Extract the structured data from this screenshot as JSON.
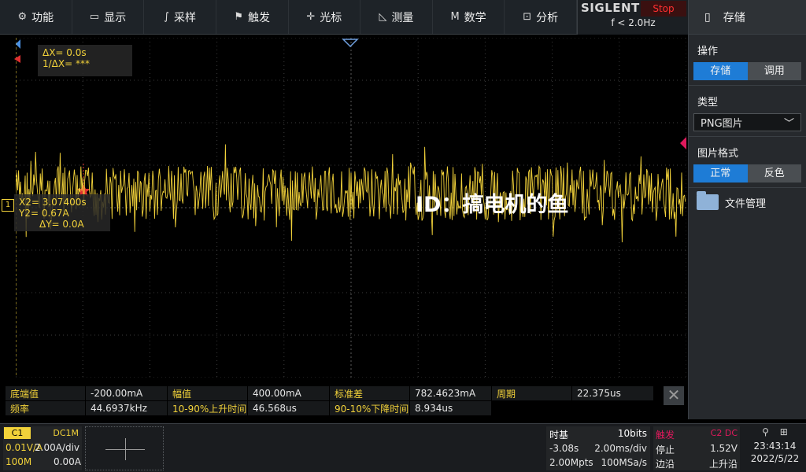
{
  "menu": [
    {
      "icon": "gear-icon",
      "glyph": "⚙",
      "label": "功能"
    },
    {
      "icon": "display-icon",
      "glyph": "▭",
      "label": "显示"
    },
    {
      "icon": "acquire-icon",
      "glyph": "∫",
      "label": "采样"
    },
    {
      "icon": "flag-icon",
      "glyph": "⚑",
      "label": "触发"
    },
    {
      "icon": "cursor-icon",
      "glyph": "✛",
      "label": "光标"
    },
    {
      "icon": "measure-icon",
      "glyph": "◺",
      "label": "测量"
    },
    {
      "icon": "math-icon",
      "glyph": "M",
      "label": "数学"
    },
    {
      "icon": "analysis-icon",
      "glyph": "⊡",
      "label": "分析"
    }
  ],
  "brand": {
    "logo": "SIGLENT",
    "status": "Stop",
    "freq": "f < 2.0Hz"
  },
  "panel": {
    "title": "存储",
    "op_label": "操作",
    "op_options": [
      "存储",
      "调用"
    ],
    "type_label": "类型",
    "type_value": "PNG图片",
    "format_label": "图片格式",
    "format_options": [
      "正常",
      "反色"
    ],
    "file_manager": "文件管理"
  },
  "cursor": {
    "dx": "ΔX= 0.0s",
    "inv_dx": "1/ΔX= ***",
    "x2": "X2= 3.07400s",
    "y2": "Y2= 0.67A",
    "dy": "ΔY= 0.0A"
  },
  "watermark": "ID：搞电机的鱼",
  "measurements": [
    [
      {
        "k": "底端值",
        "v": "-200.00mA"
      },
      {
        "k": "幅值",
        "v": "400.00mA"
      },
      {
        "k": "标准差",
        "v": "782.4623mA"
      },
      {
        "k": "周期",
        "v": "22.375us"
      }
    ],
    [
      {
        "k": "频率",
        "v": "44.6937kHz"
      },
      {
        "k": "10-90%上升时间",
        "v": "46.568us"
      },
      {
        "k": "90-10%下降时间",
        "v": "8.934us"
      }
    ]
  ],
  "channel1": {
    "tag": "C1",
    "coupling": "DC1M",
    "probe": "0.01V/A",
    "scale": "2.00A/div",
    "bandwidth": "100M",
    "offset": "0.00A"
  },
  "timebase": {
    "label": "时基",
    "bits": "10bits",
    "delay": "-3.08s",
    "scale": "2.00ms/div",
    "points": "2.00Mpts",
    "rate": "100MSa/s"
  },
  "trigger": {
    "label": "触发",
    "source": "C2 DC",
    "mode": "停止",
    "level": "1.52V",
    "type": "边沿",
    "slope": "上升沿"
  },
  "clock": {
    "time": "23:43:14",
    "date": "2022/5/22"
  },
  "colors": {
    "trace": "#f2d23a",
    "accent": "#1e7cd6",
    "stop": "#ff3030",
    "trigger": "#e0195c"
  }
}
